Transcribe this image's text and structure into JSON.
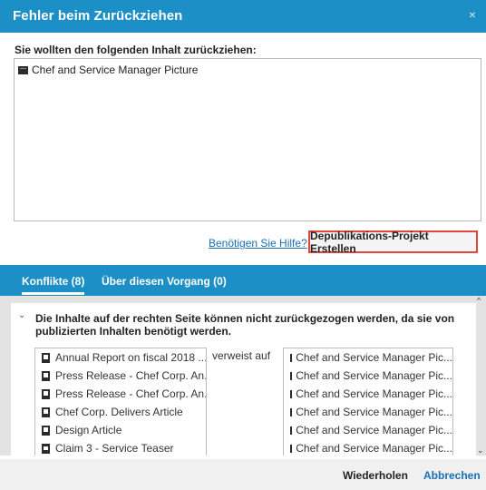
{
  "dialog": {
    "title": "Fehler beim Zurückziehen",
    "close_glyph": "×",
    "prompt": "Sie wollten den folgenden Inhalt zurückziehen:",
    "content_item": {
      "label": "Chef and Service Manager Picture",
      "icon": "image-icon"
    },
    "help_link": "Benötigen Sie Hilfe?",
    "create_project_button": "Depublikations-Projekt Erstellen"
  },
  "tabs": [
    {
      "label": "Konflikte (8)",
      "active": true
    },
    {
      "label": "Über diesen Vorgang (0)",
      "active": false
    }
  ],
  "conflict": {
    "chevron": "⌄",
    "message": "Die Inhalte auf der rechten Seite können nicht zurückgezogen werden, da sie von publizierten Inhalten benötigt werden.",
    "relation": "verweist auf",
    "left_items": [
      {
        "label": "Annual Report on fiscal 2018 ...",
        "icon": "document-icon"
      },
      {
        "label": "Press Release - Chef Corp. An...",
        "icon": "document-icon"
      },
      {
        "label": "Press Release - Chef Corp. An...",
        "icon": "document-icon"
      },
      {
        "label": "Chef Corp. Delivers Article",
        "icon": "document-icon"
      },
      {
        "label": "Design Article",
        "icon": "document-icon"
      },
      {
        "label": "Claim 3 - Service Teaser",
        "icon": "teaser-icon"
      }
    ],
    "right_items": [
      {
        "label": "Chef and Service Manager Pic...",
        "icon": "image-icon"
      },
      {
        "label": "Chef and Service Manager Pic...",
        "icon": "image-icon"
      },
      {
        "label": "Chef and Service Manager Pic...",
        "icon": "image-icon"
      },
      {
        "label": "Chef and Service Manager Pic...",
        "icon": "image-icon"
      },
      {
        "label": "Chef and Service Manager Pic...",
        "icon": "image-icon"
      },
      {
        "label": "Chef and Service Manager Pic...",
        "icon": "image-icon"
      }
    ]
  },
  "footer": {
    "retry": "Wiederholen",
    "cancel": "Abbrechen"
  },
  "colors": {
    "accent": "#1c8fc7",
    "highlight_border": "#e0463c",
    "link": "#1a6fb3"
  }
}
